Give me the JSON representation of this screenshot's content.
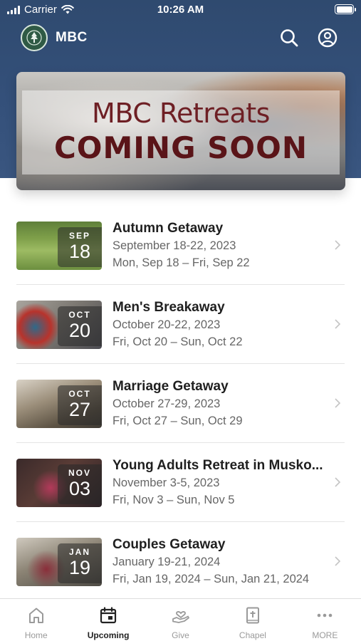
{
  "status_bar": {
    "carrier": "Carrier",
    "time": "10:26 AM"
  },
  "app_bar": {
    "title": "MBC",
    "search_icon": "search-icon",
    "account_icon": "account-icon"
  },
  "banner": {
    "line1": "MBC Retreats",
    "line2": "COMING SOON"
  },
  "events": [
    {
      "month": "SEP",
      "day": "18",
      "title": "Autumn Getaway",
      "dates": "September 18-22, 2023",
      "range": "Mon, Sep 18 – Fri, Sep 22"
    },
    {
      "month": "OCT",
      "day": "20",
      "title": "Men's Breakaway",
      "dates": "October 20-22, 2023",
      "range": "Fri, Oct 20 – Sun, Oct 22"
    },
    {
      "month": "OCT",
      "day": "27",
      "title": "Marriage Getaway",
      "dates": "October 27-29, 2023",
      "range": "Fri, Oct 27 – Sun, Oct 29"
    },
    {
      "month": "NOV",
      "day": "03",
      "title": "Young Adults Retreat in Musko...",
      "dates": "November 3-5, 2023",
      "range": "Fri, Nov 3 – Sun, Nov 5"
    },
    {
      "month": "JAN",
      "day": "19",
      "title": "Couples Getaway",
      "dates": "January 19-21, 2024",
      "range": "Fri, Jan 19, 2024 – Sun, Jan 21, 2024"
    }
  ],
  "tabs": [
    {
      "label": "Home",
      "icon": "home-icon",
      "active": false
    },
    {
      "label": "Upcoming",
      "icon": "calendar-icon",
      "active": true
    },
    {
      "label": "Give",
      "icon": "give-icon",
      "active": false
    },
    {
      "label": "Chapel",
      "icon": "bible-icon",
      "active": false
    },
    {
      "label": "MORE",
      "icon": "more-icon",
      "active": false
    }
  ],
  "colors": {
    "header": "#34507a",
    "banner_text": "#6e1f24",
    "active_tab": "#222222",
    "inactive_tab": "#9a9a9a"
  }
}
